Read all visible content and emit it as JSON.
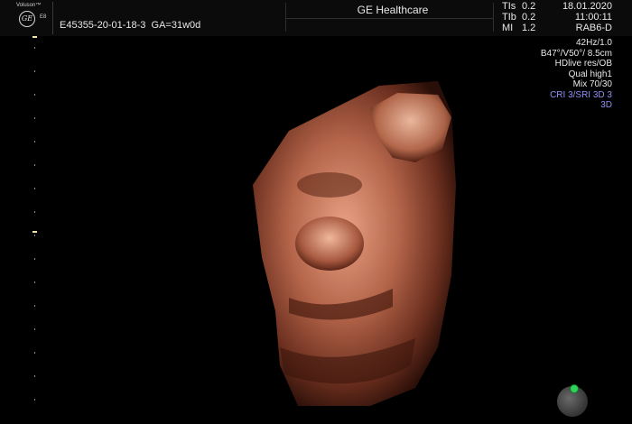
{
  "header": {
    "logo_brand": "Voluson™",
    "logo_mark": "GE",
    "logo_model": "E8",
    "patient_id": "E45355-20-01-18-3",
    "gestational_age": "GA=31w0d",
    "brand": "GE Healthcare",
    "indices": [
      {
        "label": "TIs",
        "value": "0.2"
      },
      {
        "label": "TIb",
        "value": "0.2"
      },
      {
        "label": "MI",
        "value": "1.2"
      }
    ],
    "date": "18.01.2020",
    "time": "11:00:11",
    "probe": "RAB6-D"
  },
  "params": {
    "lines": [
      "42Hz/1.0",
      "B47°/V50°/ 8.5cm",
      "HDlive res/OB",
      "Qual high1",
      "Mix 70/30"
    ],
    "accent_lines": [
      "CRI 3/SRI 3D 3",
      "3D"
    ]
  },
  "colors": {
    "accent": "#8f8ff5",
    "background": "#000000",
    "orientation_marker": "#2fd35a"
  },
  "icons": {
    "logo": "ge-logo-icon",
    "orientation": "orientation-ball-icon"
  },
  "image": {
    "mode": "3D",
    "subject": "fetal face render"
  }
}
